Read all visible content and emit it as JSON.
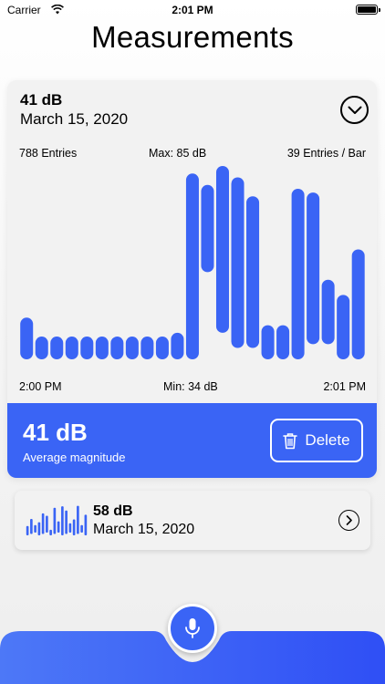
{
  "status_bar": {
    "carrier": "Carrier",
    "time": "2:01 PM"
  },
  "title": "Measurements",
  "colors": {
    "accent": "#3a64f5",
    "card": "#f2f2f2"
  },
  "current": {
    "db": "41 dB",
    "date": "March 15, 2020",
    "stats": {
      "entries": "788  Entries",
      "max": "Max: 85 dB",
      "per_bar": "39  Entries / Bar"
    },
    "axis": {
      "start": "2:00 PM",
      "min": "Min: 34 dB",
      "end": "2:01 PM"
    },
    "average_value": "41 dB",
    "average_label": "Average magnitude",
    "delete_label": "Delete"
  },
  "chart_data": {
    "type": "bar",
    "style": "floating rounded bars (range per bar)",
    "color": "#3a64f5",
    "ylim": [
      34,
      85
    ],
    "bars": [
      {
        "low": 34,
        "high": 45
      },
      {
        "low": 34,
        "high": 40
      },
      {
        "low": 34,
        "high": 40
      },
      {
        "low": 34,
        "high": 40
      },
      {
        "low": 34,
        "high": 40
      },
      {
        "low": 34,
        "high": 40
      },
      {
        "low": 34,
        "high": 40
      },
      {
        "low": 34,
        "high": 40
      },
      {
        "low": 34,
        "high": 40
      },
      {
        "low": 34,
        "high": 40
      },
      {
        "low": 34,
        "high": 41
      },
      {
        "low": 34,
        "high": 83
      },
      {
        "low": 57,
        "high": 80
      },
      {
        "low": 41,
        "high": 85
      },
      {
        "low": 37,
        "high": 82
      },
      {
        "low": 37,
        "high": 77
      },
      {
        "low": 34,
        "high": 43
      },
      {
        "low": 34,
        "high": 43
      },
      {
        "low": 34,
        "high": 79
      },
      {
        "low": 38,
        "high": 78
      },
      {
        "low": 38,
        "high": 55
      },
      {
        "low": 34,
        "high": 51
      },
      {
        "low": 34,
        "high": 63
      }
    ]
  },
  "entries": [
    {
      "db": "58 dB",
      "date": "March 15, 2020",
      "sparkline": [
        40,
        46,
        38,
        44,
        52,
        48,
        36,
        58,
        42,
        61,
        55,
        40,
        47,
        60,
        38,
        52
      ]
    }
  ]
}
